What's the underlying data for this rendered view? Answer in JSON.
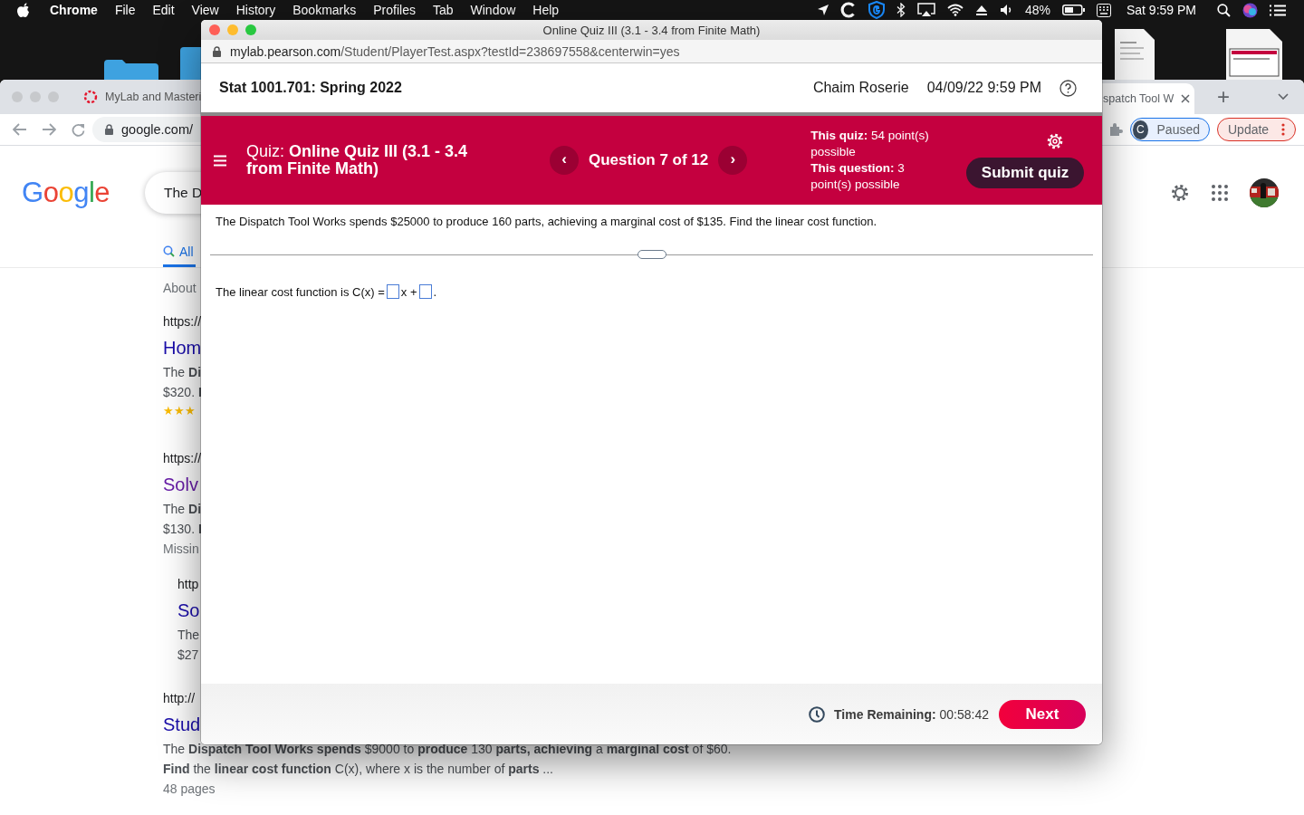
{
  "menubar": {
    "app": "Chrome",
    "menus": [
      "File",
      "Edit",
      "View",
      "History",
      "Bookmarks",
      "Profiles",
      "Tab",
      "Window",
      "Help"
    ],
    "battery": "48%",
    "clock": "Sat 9:59 PM"
  },
  "browser": {
    "tabs": [
      {
        "label": "MyLab and Masteri",
        "selected": false
      },
      {
        "label": "spatch Tool W",
        "selected": true
      }
    ],
    "new_tab": "+",
    "address": "google.com/",
    "profile": {
      "initial": "C",
      "label": "Paused"
    },
    "update": "Update",
    "google": {
      "logo": "Google",
      "query": "The D",
      "nav": [
        {
          "label": "All",
          "selected": true
        }
      ],
      "stats": "About",
      "results": [
        {
          "url": "https://",
          "title": "Hom",
          "visited": false,
          "indented": false,
          "lines": [
            "The **Di**",
            "$320. **I**"
          ],
          "stars": 3
        },
        {
          "url": "https://",
          "title": "Solv",
          "visited": true,
          "indented": false,
          "lines": [
            "The **Di**",
            "$130. **I**"
          ],
          "note": "Missin"
        },
        {
          "url": "http",
          "title": "So",
          "visited": false,
          "indented": true,
          "lines": [
            "The",
            "$27"
          ]
        },
        {
          "url": "http://",
          "title": "Stud",
          "visited": false,
          "indented": false,
          "lines": [
            "The **Dispatch Tool Works spends** $9000 to **produce** 130 **parts, achieving** a **marginal cost** of $60.",
            "**Find** the **linear cost function** C(x), where x is the number of **parts** ..."
          ],
          "note": "48 pages"
        }
      ]
    }
  },
  "quiz_window": {
    "title": "Online Quiz III (3.1 - 3.4 from Finite Math)",
    "url": {
      "host": "mylab.pearson.com",
      "path": "/Student/PlayerTest.aspx?testId=238697558&centerwin=yes"
    },
    "course": "Stat 1001.701: Spring 2022",
    "user": "Chaim Roserie",
    "datetime": "04/09/22 9:59 PM",
    "quiz_title": "Quiz:  **Online Quiz III (3.1 - 3.4 from Finite Math)**",
    "prev": "‹",
    "question_label": "Question 7 of 12",
    "next_arrow": "›",
    "points": [
      "**This quiz:** 54 point(s) possible",
      "**This question:** 3 point(s) possible"
    ],
    "submit": "Submit quiz",
    "question": "The Dispatch Tool Works spends $25000 to produce 160 parts, achieving a marginal cost of $135. Find the linear cost function.",
    "answer": {
      "prefix": "The linear cost function is C(x) =",
      "middle": "x +",
      "suffix": "."
    },
    "timer": {
      "label": "Time Remaining:",
      "value": "00:58:42"
    },
    "next": "Next"
  }
}
